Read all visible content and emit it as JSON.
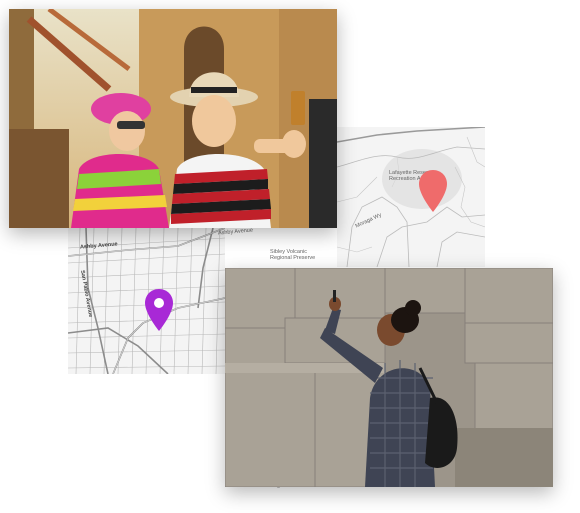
{
  "images": {
    "kids_photo": {
      "subject": "children-with-smartphone-photo"
    },
    "woman_photo": {
      "subject": "woman-photographing-with-phone-photo"
    }
  },
  "map_top_right": {
    "labels": {
      "recreation_area": "Lafayette Reserv\nRecreation Ar",
      "road": "Moraga Wy"
    },
    "pin_color": "#ef6b6b"
  },
  "map_left": {
    "labels": {
      "ashby_avenue": "Ashby Avenue",
      "ashby_avenue_2": "Ashby Avenue",
      "san_pablo_avenue": "San Pablo Avenue",
      "sibley": "Sibley Volcanic\nRegional Preserve"
    },
    "pin_color": "#a829d6"
  },
  "colors": {
    "map_background": "#f4f4f4",
    "map_roads": "#9a9a9a",
    "page_background": "#ffffff"
  }
}
